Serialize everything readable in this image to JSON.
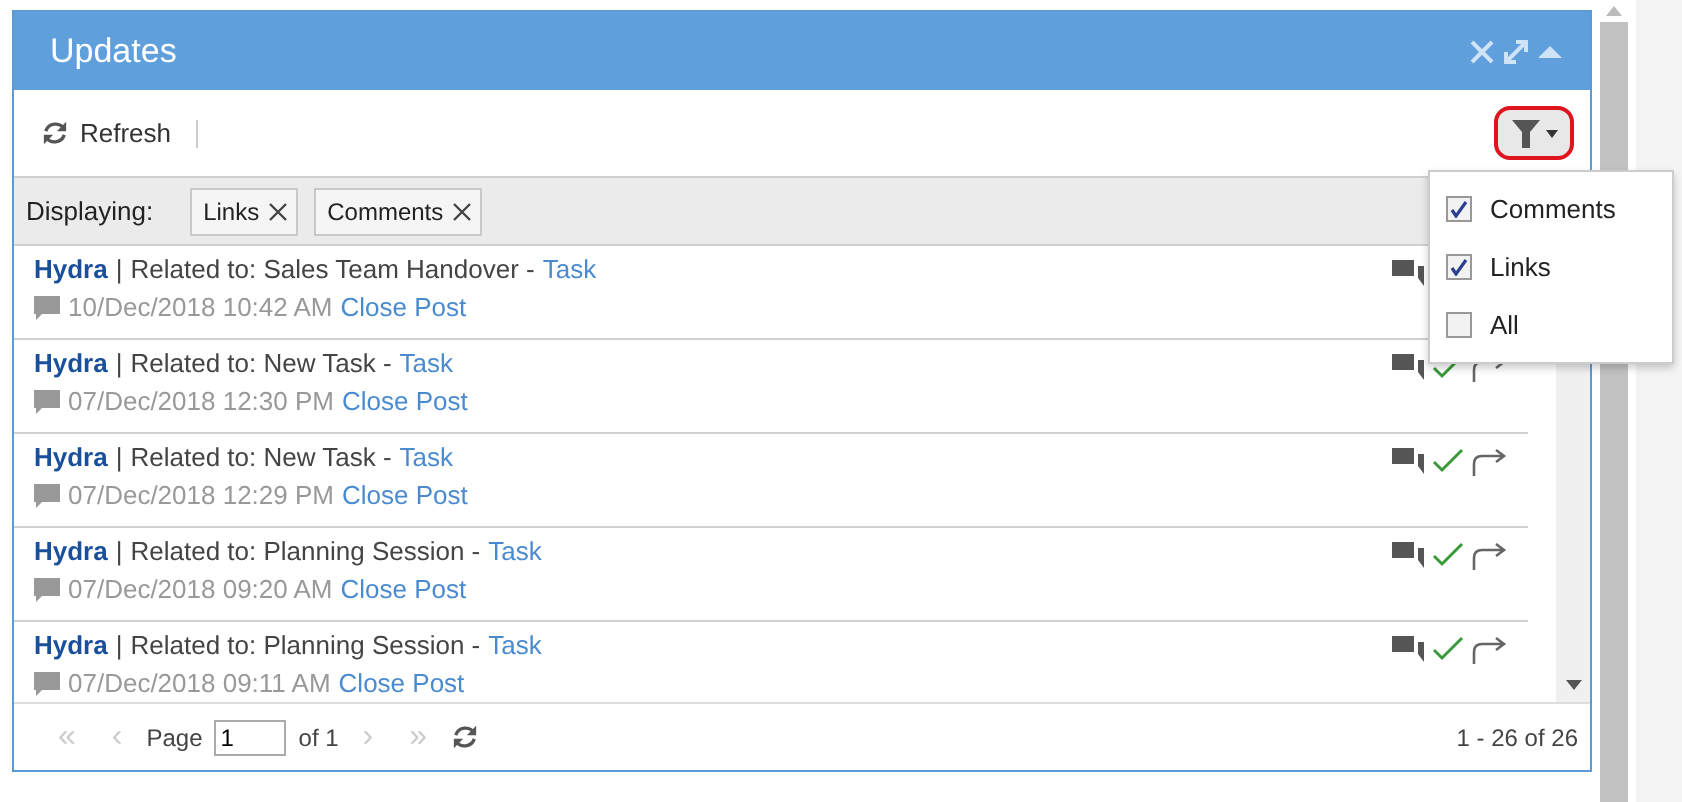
{
  "panel": {
    "title": "Updates"
  },
  "toolbar": {
    "refresh": "Refresh"
  },
  "filter_bar": {
    "label": "Displaying:",
    "chips": [
      "Links",
      "Comments"
    ]
  },
  "filter_menu": [
    {
      "label": "Comments",
      "checked": true
    },
    {
      "label": "Links",
      "checked": true
    },
    {
      "label": "All",
      "checked": false
    }
  ],
  "posts": [
    {
      "author": "Hydra",
      "related": "Related to: Sales Team Handover -",
      "link": "Task",
      "date": "10/Dec/2018 10:42 AM",
      "action": "Close Post"
    },
    {
      "author": "Hydra",
      "related": "Related to: New Task -",
      "link": "Task",
      "date": "07/Dec/2018 12:30 PM",
      "action": "Close Post"
    },
    {
      "author": "Hydra",
      "related": "Related to: New Task -",
      "link": "Task",
      "date": "07/Dec/2018 12:29 PM",
      "action": "Close Post"
    },
    {
      "author": "Hydra",
      "related": "Related to: Planning Session -",
      "link": "Task",
      "date": "07/Dec/2018 09:20 AM",
      "action": "Close Post"
    },
    {
      "author": "Hydra",
      "related": "Related to: Planning Session -",
      "link": "Task",
      "date": "07/Dec/2018 09:11 AM",
      "action": "Close Post"
    }
  ],
  "separator": "|",
  "pager": {
    "first": "«",
    "prev": "‹",
    "next": "›",
    "last": "»",
    "page_label": "Page",
    "page": "1",
    "of": "of 1",
    "summary": "1 - 26 of 26"
  }
}
